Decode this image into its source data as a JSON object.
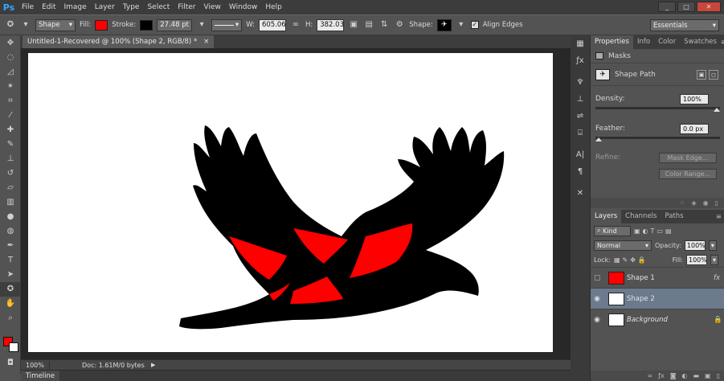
{
  "app": {
    "logo": "Ps"
  },
  "menu": [
    "File",
    "Edit",
    "Image",
    "Layer",
    "Type",
    "Select",
    "Filter",
    "View",
    "Window",
    "Help"
  ],
  "window_controls": {
    "minimize": "_",
    "maximize": "□",
    "close": "✕"
  },
  "options": {
    "tool_mode": "Shape",
    "fill_label": "Fill:",
    "fill_color": "#ff0000",
    "stroke_label": "Stroke:",
    "stroke_color": "#000000",
    "stroke_width": "27.48 pt",
    "w_label": "W:",
    "width": "605.06",
    "h_label": "H:",
    "height": "382.03",
    "shape_label": "Shape:",
    "align_edges": "Align Edges",
    "align_checked": "✓",
    "workspace": "Essentials"
  },
  "document": {
    "tab_title": "Untitled-1-Recovered @ 100% (Shape 2, RGB/8) *",
    "tab_close": "×",
    "zoom": "100%",
    "doc_info": "Doc: 1.61M/0 bytes",
    "timeline": "Timeline"
  },
  "properties": {
    "tabs": [
      "Properties",
      "Info",
      "Color",
      "Swatches"
    ],
    "masks_label": "Masks",
    "shape_path_label": "Shape Path",
    "density_label": "Density:",
    "density_value": "100%",
    "density_fraction": 1.0,
    "feather_label": "Feather:",
    "feather_value": "0.0 px",
    "feather_fraction": 0.0,
    "refine_label": "Refine:",
    "mask_edge": "Mask Edge...",
    "color_range": "Color Range..."
  },
  "layers": {
    "tabs": [
      "Layers",
      "Channels",
      "Paths"
    ],
    "filter_kind": "Kind",
    "blend_mode": "Normal",
    "opacity_label": "Opacity:",
    "opacity": "100%",
    "lock_label": "Lock:",
    "fill_label": "Fill:",
    "fill": "100%",
    "items": [
      {
        "name": "Shape 1",
        "visible": false,
        "fx": "fx",
        "selected": false
      },
      {
        "name": "Shape 2",
        "visible": true,
        "fx": "",
        "selected": true
      },
      {
        "name": "Background",
        "visible": true,
        "fx": "",
        "selected": false,
        "locked": true
      }
    ]
  },
  "colors": {
    "foreground": "#ff0000",
    "background": "#ffffff",
    "shape_fill": "#ff0000",
    "shape_stroke": "#000000"
  }
}
